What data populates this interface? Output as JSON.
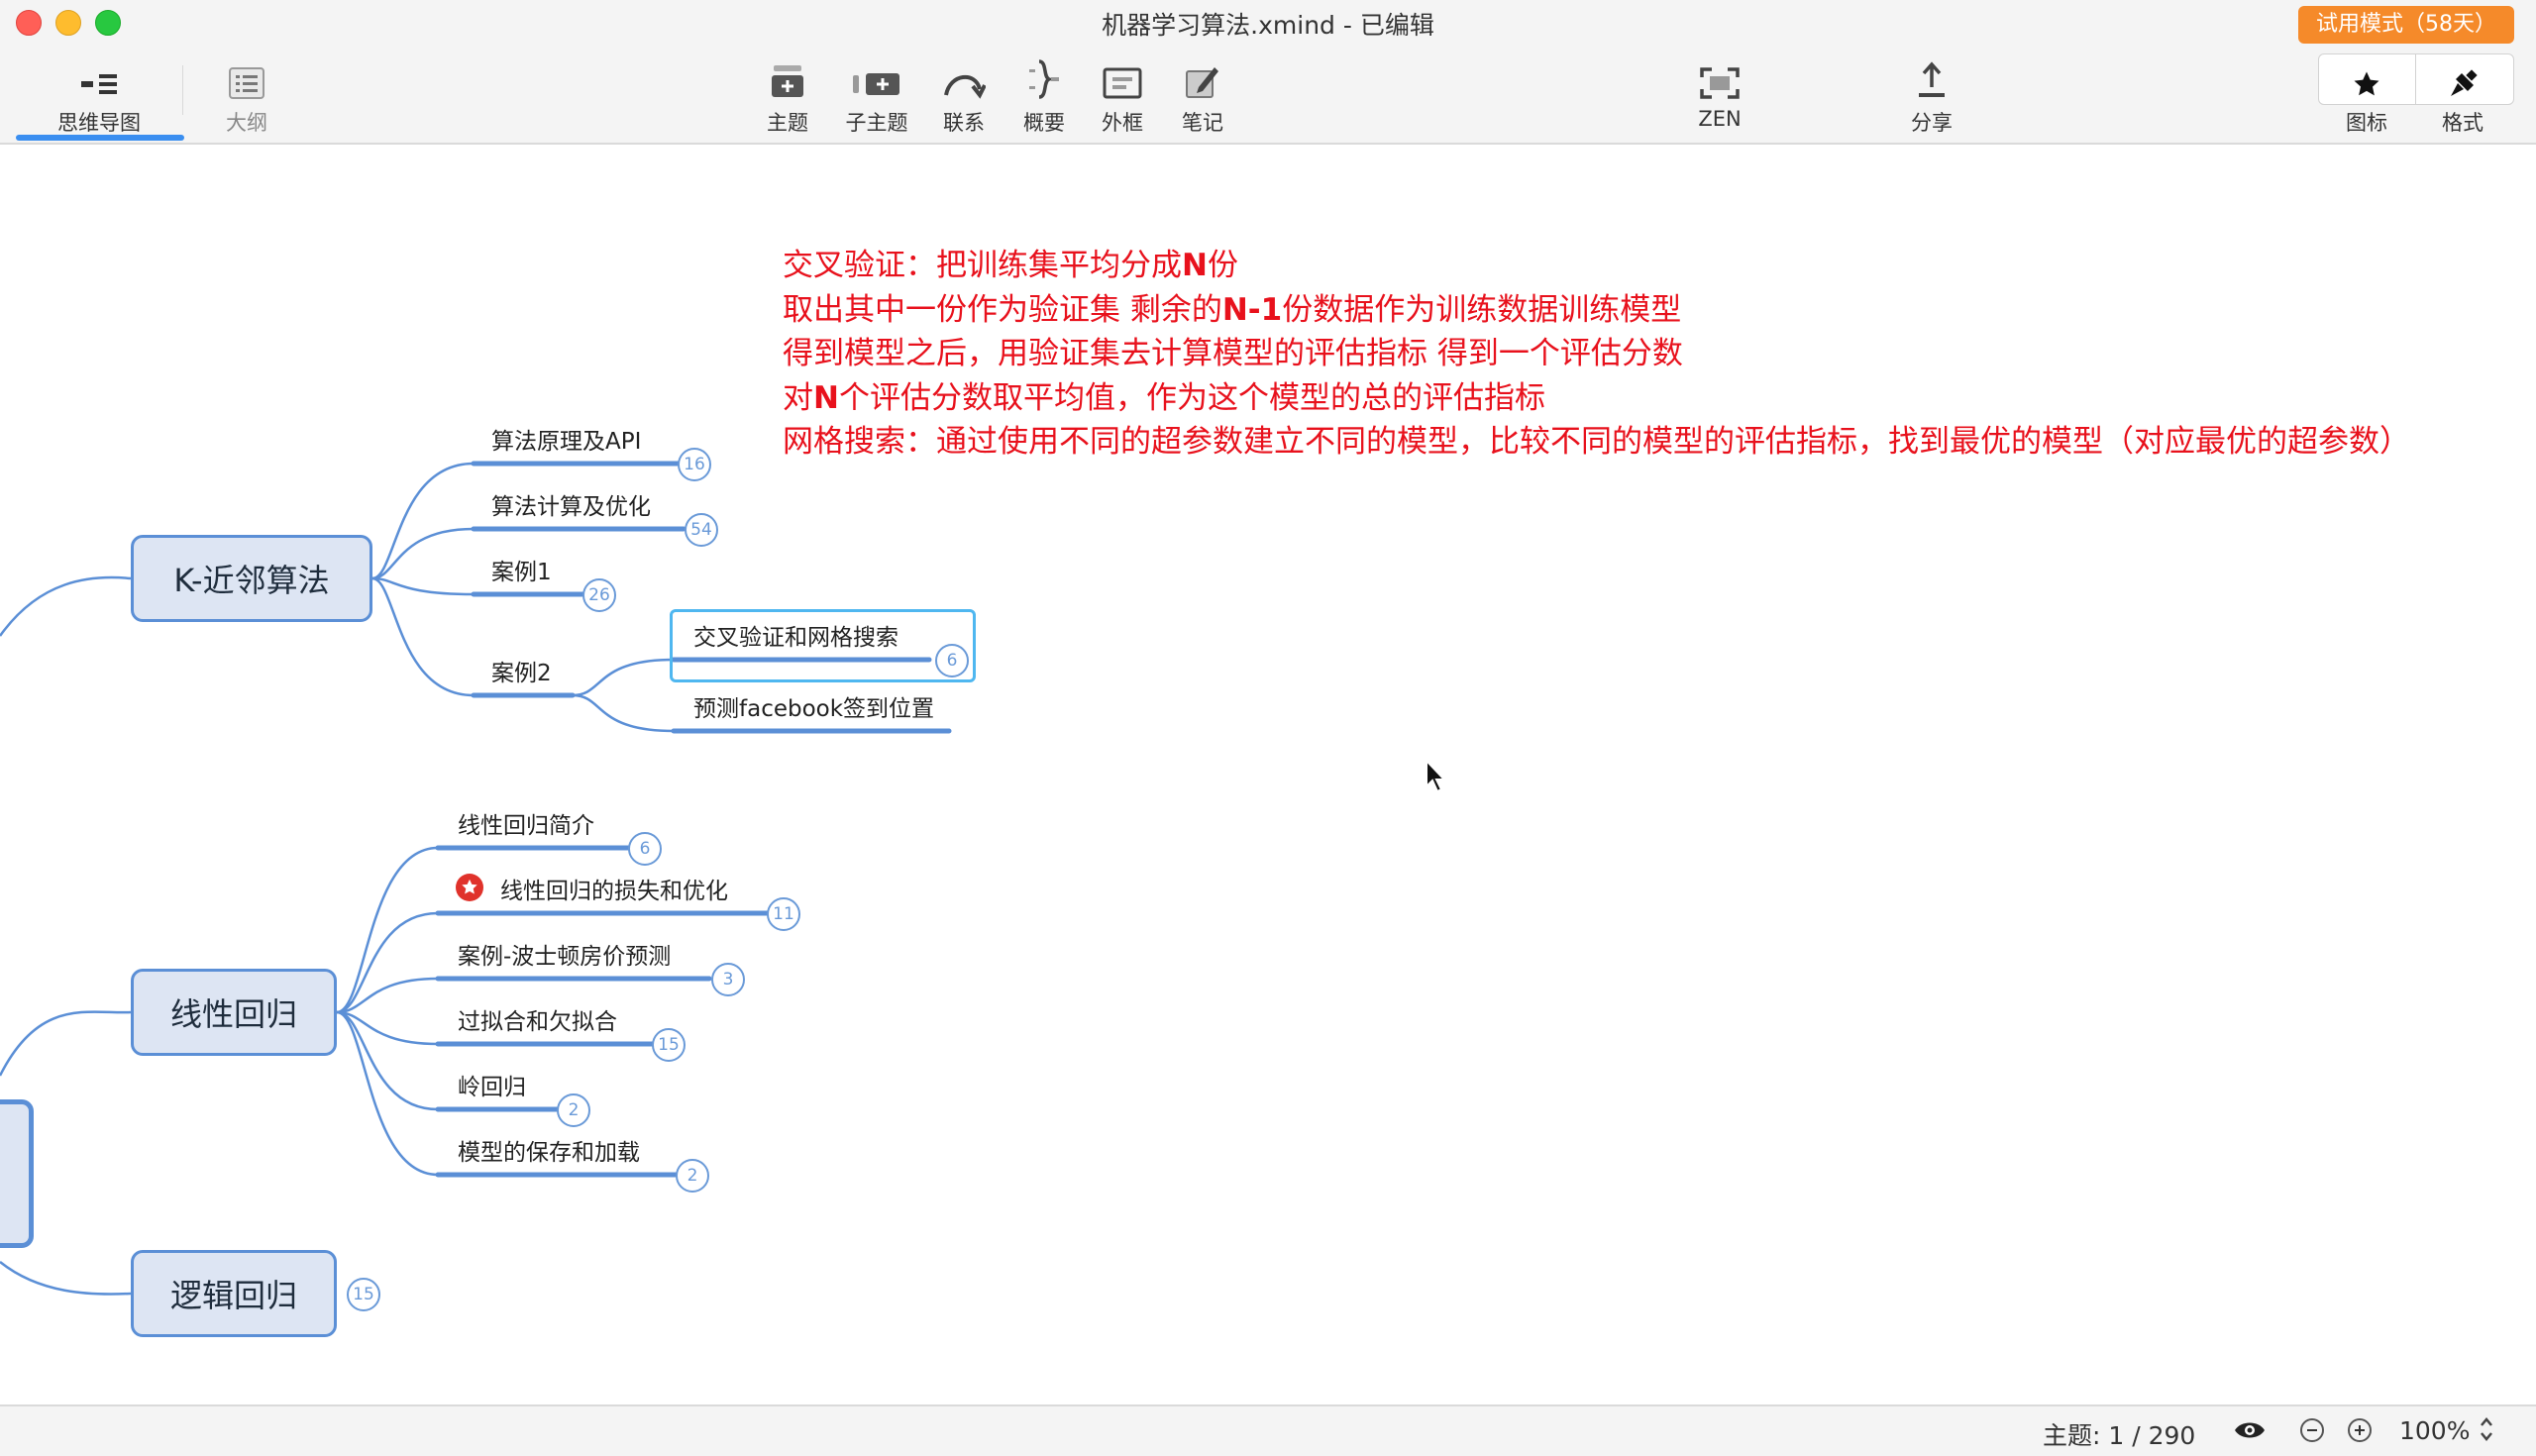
{
  "window": {
    "title": "机器学习算法.xmind - 已编辑",
    "trial_badge": "试用模式（58天）"
  },
  "toolbar": {
    "views": [
      {
        "label": "思维导图",
        "icon": "mindmap-icon",
        "active": true
      },
      {
        "label": "大纲",
        "icon": "outline-icon",
        "active": false
      }
    ],
    "center_tools": [
      {
        "label": "主题",
        "icon": "topic-icon"
      },
      {
        "label": "子主题",
        "icon": "subtopic-icon"
      },
      {
        "label": "联系",
        "icon": "relationship-icon"
      },
      {
        "label": "概要",
        "icon": "summary-icon"
      },
      {
        "label": "外框",
        "icon": "boundary-icon"
      },
      {
        "label": "笔记",
        "icon": "note-icon"
      }
    ],
    "zen": {
      "label": "ZEN",
      "icon": "zen-icon"
    },
    "share": {
      "label": "分享",
      "icon": "share-icon"
    },
    "right_tools": [
      {
        "label": "图标",
        "icon": "star-icon"
      },
      {
        "label": "格式",
        "icon": "format-brush-icon"
      }
    ]
  },
  "note": {
    "lines": [
      [
        {
          "t": "交叉验证：把训练集平均分成"
        },
        {
          "t": "N",
          "b": true
        },
        {
          "t": "份"
        }
      ],
      [
        {
          "t": "取出其中一份作为验证集  剩余的"
        },
        {
          "t": "N-1",
          "b": true
        },
        {
          "t": "份数据作为训练数据训练模型"
        }
      ],
      [
        {
          "t": "得到模型之后，用验证集去计算模型的评估指标 得到一个评估分数"
        }
      ],
      [
        {
          "t": "对"
        },
        {
          "t": "N",
          "b": true
        },
        {
          "t": "个评估分数取平均值，作为这个模型的总的评估指标"
        }
      ],
      [
        {
          "t": "网格搜索：通过使用不同的超参数建立不同的模型，比较不同的模型的评估指标，找到最优的模型（对应最优的超参数）"
        }
      ]
    ],
    "color": "#e8111c"
  },
  "mindmap": {
    "knn": {
      "label": "K-近邻算法",
      "children": [
        {
          "label": "算法原理及API",
          "count": "16"
        },
        {
          "label": "算法计算及优化",
          "count": "54"
        },
        {
          "label": "案例1",
          "count": "26"
        },
        {
          "label": "案例2",
          "children": [
            {
              "label": "交叉验证和网格搜索",
              "count": "6",
              "selected": true
            },
            {
              "label": "预测facebook签到位置"
            }
          ]
        }
      ]
    },
    "linear": {
      "label": "线性回归",
      "children": [
        {
          "label": "线性回归简介",
          "count": "6"
        },
        {
          "label": "线性回归的损失和优化",
          "count": "11",
          "marker": "star-marker-icon"
        },
        {
          "label": "案例-波士顿房价预测",
          "count": "3"
        },
        {
          "label": "过拟合和欠拟合",
          "count": "15"
        },
        {
          "label": "岭回归",
          "count": "2"
        },
        {
          "label": "模型的保存和加载",
          "count": "2"
        }
      ]
    },
    "logistic": {
      "label": "逻辑回归",
      "count": "15"
    }
  },
  "status": {
    "topic_count": "主题: 1 / 290",
    "zoom": "100%"
  },
  "colors": {
    "accent": "#3a8ef0",
    "branch_line": "#5b8fd6",
    "topic_fill": "#dde5f3",
    "trial": "#f58a2a"
  }
}
